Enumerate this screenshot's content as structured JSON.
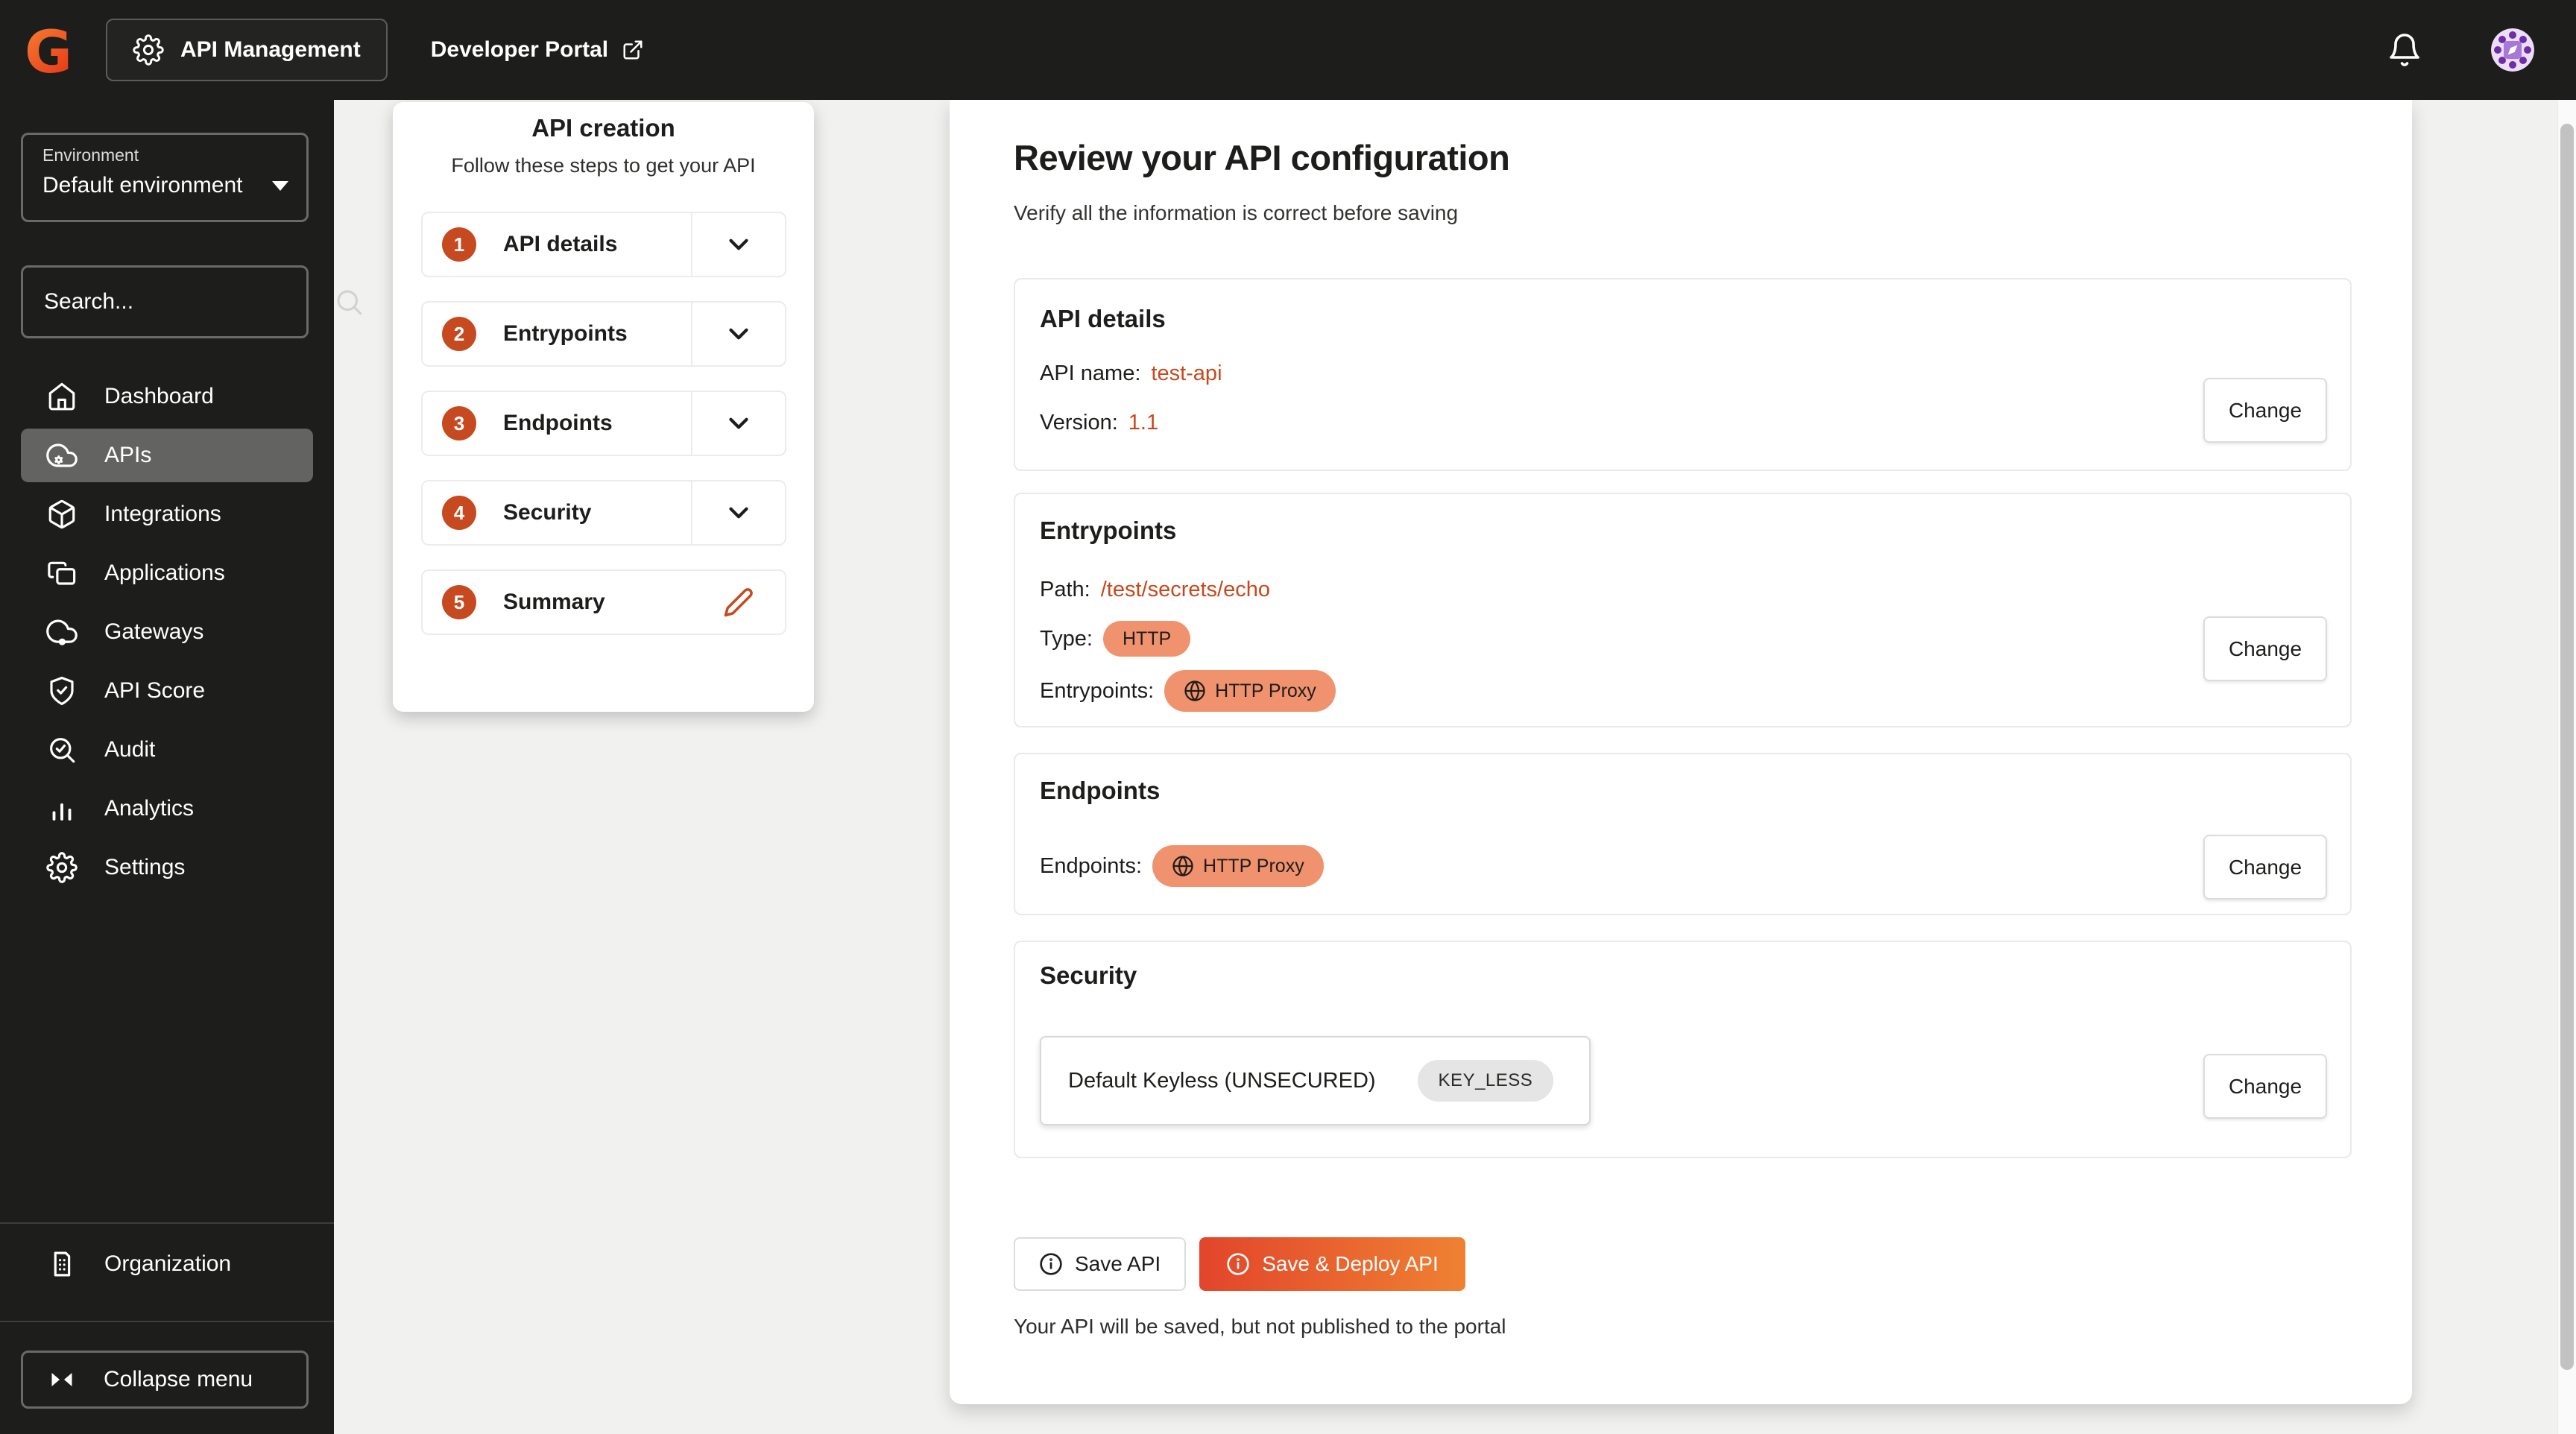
{
  "colors": {
    "accent": "#c7491f",
    "accent_text": "#c8481d",
    "pill_salmon": "#f0926d",
    "pill_gray": "#e5e5e5",
    "deploy_gradient_start": "#e2452b",
    "deploy_gradient_end": "#ef8132",
    "topbar_bg": "#1d1d1b",
    "sidebar_bg": "#1d1d1b",
    "active_nav_bg": "#636361",
    "page_bg": "#f1f1f0"
  },
  "topbar": {
    "logo": "gravitee-logo",
    "app_switcher": "API Management",
    "developer_portal": "Developer Portal",
    "icons": [
      "gear-icon",
      "external-link-icon",
      "bell-icon",
      "avatar"
    ]
  },
  "sidebar": {
    "environment_label": "Environment",
    "environment_value": "Default environment",
    "search_placeholder": "Search...",
    "items": [
      {
        "label": "Dashboard",
        "icon": "home-icon",
        "active": false
      },
      {
        "label": "APIs",
        "icon": "cloud-gear-icon",
        "active": true
      },
      {
        "label": "Integrations",
        "icon": "cube-icon",
        "active": false
      },
      {
        "label": "Applications",
        "icon": "windows-icon",
        "active": false
      },
      {
        "label": "Gateways",
        "icon": "cloud-node-icon",
        "active": false
      },
      {
        "label": "API Score",
        "icon": "shield-check-icon",
        "active": false
      },
      {
        "label": "Audit",
        "icon": "search-check-icon",
        "active": false
      },
      {
        "label": "Analytics",
        "icon": "bar-chart-icon",
        "active": false
      },
      {
        "label": "Settings",
        "icon": "gear-icon",
        "active": false
      }
    ],
    "organization_label": "Organization",
    "collapse_label": "Collapse menu"
  },
  "stepper": {
    "title": "API creation",
    "subtitle": "Follow these steps to get your API",
    "steps": [
      {
        "number": "1",
        "label": "API details",
        "icon": "chevron-down-icon"
      },
      {
        "number": "2",
        "label": "Entrypoints",
        "icon": "chevron-down-icon"
      },
      {
        "number": "3",
        "label": "Endpoints",
        "icon": "chevron-down-icon"
      },
      {
        "number": "4",
        "label": "Security",
        "icon": "chevron-down-icon"
      },
      {
        "number": "5",
        "label": "Summary",
        "icon": "pencil-icon"
      }
    ]
  },
  "main": {
    "title": "Review your API configuration",
    "subtitle": "Verify all the information is correct before saving",
    "sections": {
      "api_details": {
        "title": "API details",
        "api_name_label": "API name:",
        "api_name": "test-api",
        "version_label": "Version:",
        "version": "1.1",
        "change_label": "Change"
      },
      "entrypoints": {
        "title": "Entrypoints",
        "path_label": "Path:",
        "path": "/test/secrets/echo",
        "type_label": "Type:",
        "type_badge": "HTTP",
        "entrypoints_label": "Entrypoints:",
        "entrypoint_badge": "HTTP Proxy",
        "change_label": "Change"
      },
      "endpoints": {
        "title": "Endpoints",
        "endpoints_label": "Endpoints:",
        "endpoint_badge": "HTTP Proxy",
        "change_label": "Change"
      },
      "security": {
        "title": "Security",
        "plan_name": "Default Keyless (UNSECURED)",
        "plan_badge": "KEY_LESS",
        "change_label": "Change"
      }
    },
    "actions": {
      "save": "Save API",
      "save_deploy": "Save & Deploy API",
      "note": "Your API will be saved, but not published to the portal"
    }
  }
}
